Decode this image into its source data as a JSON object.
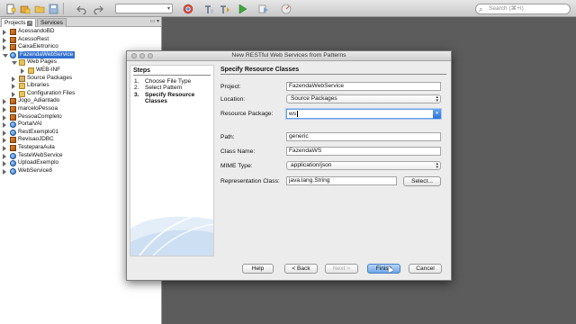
{
  "toolbar": {
    "buttons": [
      "new-file-icon",
      "new-project-icon",
      "open-project-icon",
      "save-all-icon",
      "undo-icon",
      "redo-icon",
      "browser-icon",
      "clean-build-icon",
      "build-icon",
      "run-icon",
      "debug-icon",
      "profile-icon"
    ],
    "search_placeholder": "Search (⌘+I)"
  },
  "left_panel": {
    "tabs": [
      {
        "label": "Projects",
        "active": true
      },
      {
        "label": "Services",
        "active": false
      }
    ],
    "tree": [
      {
        "label": "AcessandoBD",
        "level": 0,
        "icon": "cube",
        "open": false
      },
      {
        "label": "AcessoRest",
        "level": 0,
        "icon": "cube",
        "open": false
      },
      {
        "label": "CaixaEletronico",
        "level": 0,
        "icon": "cube",
        "open": false
      },
      {
        "label": "FazendaWebService",
        "level": 0,
        "icon": "globe",
        "open": true,
        "selected": true
      },
      {
        "label": "Web Pages",
        "level": 1,
        "icon": "folder",
        "open": true
      },
      {
        "label": "WEB-INF",
        "level": 2,
        "icon": "folder",
        "open": false
      },
      {
        "label": "Source Packages",
        "level": 1,
        "icon": "pkg",
        "open": false
      },
      {
        "label": "Libraries",
        "level": 1,
        "icon": "folder",
        "open": false
      },
      {
        "label": "Configuration Files",
        "level": 1,
        "icon": "folder",
        "open": false
      },
      {
        "label": "Jogo_Adiantado",
        "level": 0,
        "icon": "cube",
        "open": false
      },
      {
        "label": "marceloPessoa",
        "level": 0,
        "icon": "cube",
        "open": false
      },
      {
        "label": "PessoaCompleto",
        "level": 0,
        "icon": "cube",
        "open": false
      },
      {
        "label": "PortalVAI",
        "level": 0,
        "icon": "globe",
        "open": false
      },
      {
        "label": "RestExemplo01",
        "level": 0,
        "icon": "globe",
        "open": false
      },
      {
        "label": "RevisaoJDBC",
        "level": 0,
        "icon": "cube",
        "open": false
      },
      {
        "label": "TesteparaAula",
        "level": 0,
        "icon": "cube",
        "open": false
      },
      {
        "label": "TesteWebService",
        "level": 0,
        "icon": "globe",
        "open": false
      },
      {
        "label": "UploadExemplo",
        "level": 0,
        "icon": "globe",
        "open": false
      },
      {
        "label": "WebService8",
        "level": 0,
        "icon": "globe",
        "open": false
      }
    ]
  },
  "dialog": {
    "title": "New RESTful Web Services from Patterns",
    "steps_header": "Steps",
    "steps": [
      {
        "num": "1.",
        "label": "Choose File Type",
        "current": false
      },
      {
        "num": "2.",
        "label": "Select Pattern",
        "current": false
      },
      {
        "num": "3.",
        "label": "Specify Resource Classes",
        "current": true
      }
    ],
    "content_header": "Specify Resource Classes",
    "fields": {
      "project_label": "Project:",
      "project_value": "FazendaWebService",
      "location_label": "Location:",
      "location_value": "Source Packages",
      "package_label": "Resource Package:",
      "package_value": "ws",
      "path_label": "Path:",
      "path_value": "generic",
      "class_label": "Class Name:",
      "class_value": "FazendaWS",
      "mime_label": "MIME Type:",
      "mime_value": "application/json",
      "repr_label": "Representation Class:",
      "repr_value": "java.lang.String"
    },
    "buttons": {
      "select": "Select...",
      "help": "Help",
      "back": "< Back",
      "next": "Next >",
      "finish": "Finish",
      "cancel": "Cancel"
    }
  }
}
